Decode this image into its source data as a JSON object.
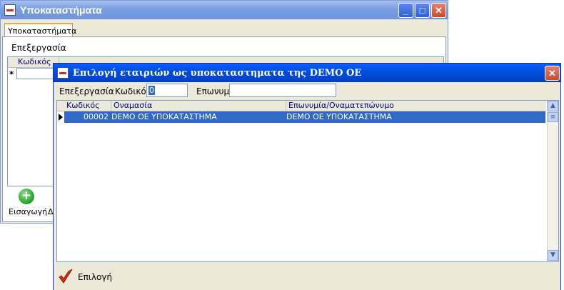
{
  "background_window": {
    "title": "Υποκαταστήματα",
    "tab_label": "Υποκαταστήματα",
    "menu_label": "Επεξεργασία",
    "grid": {
      "col_code": "Κωδικός",
      "new_row_marker": "*"
    },
    "insert_label": "Εισαγωγή",
    "truncated_label": "Δ"
  },
  "dialog": {
    "title": "Επιλογή εταιριών ως υποκαταστηματα της DEMO OE",
    "toolbar": {
      "menu_label": "Επεξεργασία",
      "code_label": "Κωδικός",
      "code_value": "0",
      "name_label": "Επωνυμία",
      "name_value": ""
    },
    "grid": {
      "columns": [
        "Κωδικός",
        "Οναμασία",
        "Επωνυμία/Οναματεπώνυμο"
      ],
      "rows": [
        {
          "code": "00002",
          "title": "DEMO OE ΥΠΟΚΑΤΑΣΤΗΜΑ",
          "name": "DEMO OE ΥΠΟΚΑΤΑΣΤΗΜΑ"
        }
      ]
    },
    "select_label": "Επιλογή"
  },
  "icons": {
    "close": "close-icon",
    "minimize": "minimize-icon",
    "maximize": "maximize-icon",
    "add": "plus-circle-icon",
    "select": "checkmark-icon"
  },
  "colors": {
    "title_active": "#0050e0",
    "title_inactive": "#7a9ee0",
    "row_selected": "#316ac5",
    "header_text": "#00008b",
    "add_button": "#2eaa2e",
    "checkmark": "#d03018"
  }
}
